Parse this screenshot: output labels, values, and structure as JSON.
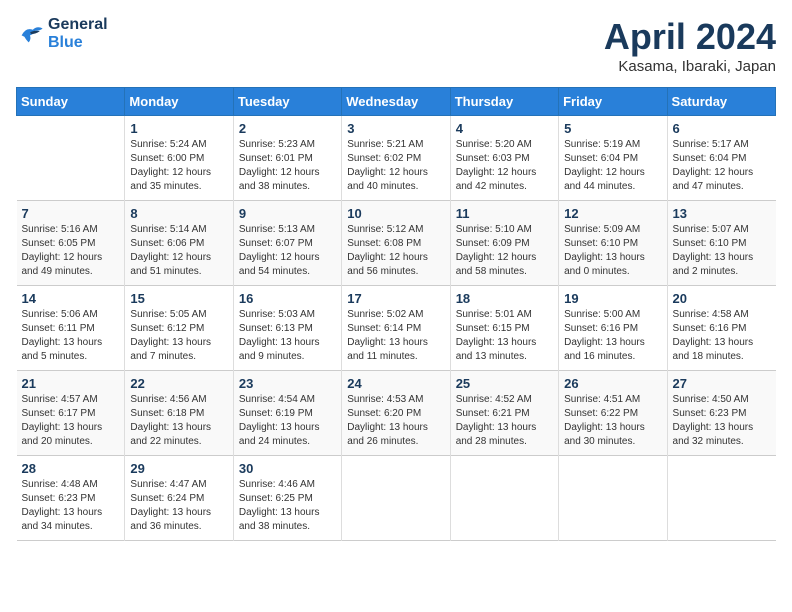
{
  "header": {
    "logo_line1": "General",
    "logo_line2": "Blue",
    "month_title": "April 2024",
    "location": "Kasama, Ibaraki, Japan"
  },
  "calendar": {
    "weekdays": [
      "Sunday",
      "Monday",
      "Tuesday",
      "Wednesday",
      "Thursday",
      "Friday",
      "Saturday"
    ],
    "weeks": [
      [
        {
          "day": "",
          "text": ""
        },
        {
          "day": "1",
          "text": "Sunrise: 5:24 AM\nSunset: 6:00 PM\nDaylight: 12 hours\nand 35 minutes."
        },
        {
          "day": "2",
          "text": "Sunrise: 5:23 AM\nSunset: 6:01 PM\nDaylight: 12 hours\nand 38 minutes."
        },
        {
          "day": "3",
          "text": "Sunrise: 5:21 AM\nSunset: 6:02 PM\nDaylight: 12 hours\nand 40 minutes."
        },
        {
          "day": "4",
          "text": "Sunrise: 5:20 AM\nSunset: 6:03 PM\nDaylight: 12 hours\nand 42 minutes."
        },
        {
          "day": "5",
          "text": "Sunrise: 5:19 AM\nSunset: 6:04 PM\nDaylight: 12 hours\nand 44 minutes."
        },
        {
          "day": "6",
          "text": "Sunrise: 5:17 AM\nSunset: 6:04 PM\nDaylight: 12 hours\nand 47 minutes."
        }
      ],
      [
        {
          "day": "7",
          "text": "Sunrise: 5:16 AM\nSunset: 6:05 PM\nDaylight: 12 hours\nand 49 minutes."
        },
        {
          "day": "8",
          "text": "Sunrise: 5:14 AM\nSunset: 6:06 PM\nDaylight: 12 hours\nand 51 minutes."
        },
        {
          "day": "9",
          "text": "Sunrise: 5:13 AM\nSunset: 6:07 PM\nDaylight: 12 hours\nand 54 minutes."
        },
        {
          "day": "10",
          "text": "Sunrise: 5:12 AM\nSunset: 6:08 PM\nDaylight: 12 hours\nand 56 minutes."
        },
        {
          "day": "11",
          "text": "Sunrise: 5:10 AM\nSunset: 6:09 PM\nDaylight: 12 hours\nand 58 minutes."
        },
        {
          "day": "12",
          "text": "Sunrise: 5:09 AM\nSunset: 6:10 PM\nDaylight: 13 hours\nand 0 minutes."
        },
        {
          "day": "13",
          "text": "Sunrise: 5:07 AM\nSunset: 6:10 PM\nDaylight: 13 hours\nand 2 minutes."
        }
      ],
      [
        {
          "day": "14",
          "text": "Sunrise: 5:06 AM\nSunset: 6:11 PM\nDaylight: 13 hours\nand 5 minutes."
        },
        {
          "day": "15",
          "text": "Sunrise: 5:05 AM\nSunset: 6:12 PM\nDaylight: 13 hours\nand 7 minutes."
        },
        {
          "day": "16",
          "text": "Sunrise: 5:03 AM\nSunset: 6:13 PM\nDaylight: 13 hours\nand 9 minutes."
        },
        {
          "day": "17",
          "text": "Sunrise: 5:02 AM\nSunset: 6:14 PM\nDaylight: 13 hours\nand 11 minutes."
        },
        {
          "day": "18",
          "text": "Sunrise: 5:01 AM\nSunset: 6:15 PM\nDaylight: 13 hours\nand 13 minutes."
        },
        {
          "day": "19",
          "text": "Sunrise: 5:00 AM\nSunset: 6:16 PM\nDaylight: 13 hours\nand 16 minutes."
        },
        {
          "day": "20",
          "text": "Sunrise: 4:58 AM\nSunset: 6:16 PM\nDaylight: 13 hours\nand 18 minutes."
        }
      ],
      [
        {
          "day": "21",
          "text": "Sunrise: 4:57 AM\nSunset: 6:17 PM\nDaylight: 13 hours\nand 20 minutes."
        },
        {
          "day": "22",
          "text": "Sunrise: 4:56 AM\nSunset: 6:18 PM\nDaylight: 13 hours\nand 22 minutes."
        },
        {
          "day": "23",
          "text": "Sunrise: 4:54 AM\nSunset: 6:19 PM\nDaylight: 13 hours\nand 24 minutes."
        },
        {
          "day": "24",
          "text": "Sunrise: 4:53 AM\nSunset: 6:20 PM\nDaylight: 13 hours\nand 26 minutes."
        },
        {
          "day": "25",
          "text": "Sunrise: 4:52 AM\nSunset: 6:21 PM\nDaylight: 13 hours\nand 28 minutes."
        },
        {
          "day": "26",
          "text": "Sunrise: 4:51 AM\nSunset: 6:22 PM\nDaylight: 13 hours\nand 30 minutes."
        },
        {
          "day": "27",
          "text": "Sunrise: 4:50 AM\nSunset: 6:23 PM\nDaylight: 13 hours\nand 32 minutes."
        }
      ],
      [
        {
          "day": "28",
          "text": "Sunrise: 4:48 AM\nSunset: 6:23 PM\nDaylight: 13 hours\nand 34 minutes."
        },
        {
          "day": "29",
          "text": "Sunrise: 4:47 AM\nSunset: 6:24 PM\nDaylight: 13 hours\nand 36 minutes."
        },
        {
          "day": "30",
          "text": "Sunrise: 4:46 AM\nSunset: 6:25 PM\nDaylight: 13 hours\nand 38 minutes."
        },
        {
          "day": "",
          "text": ""
        },
        {
          "day": "",
          "text": ""
        },
        {
          "day": "",
          "text": ""
        },
        {
          "day": "",
          "text": ""
        }
      ]
    ]
  }
}
